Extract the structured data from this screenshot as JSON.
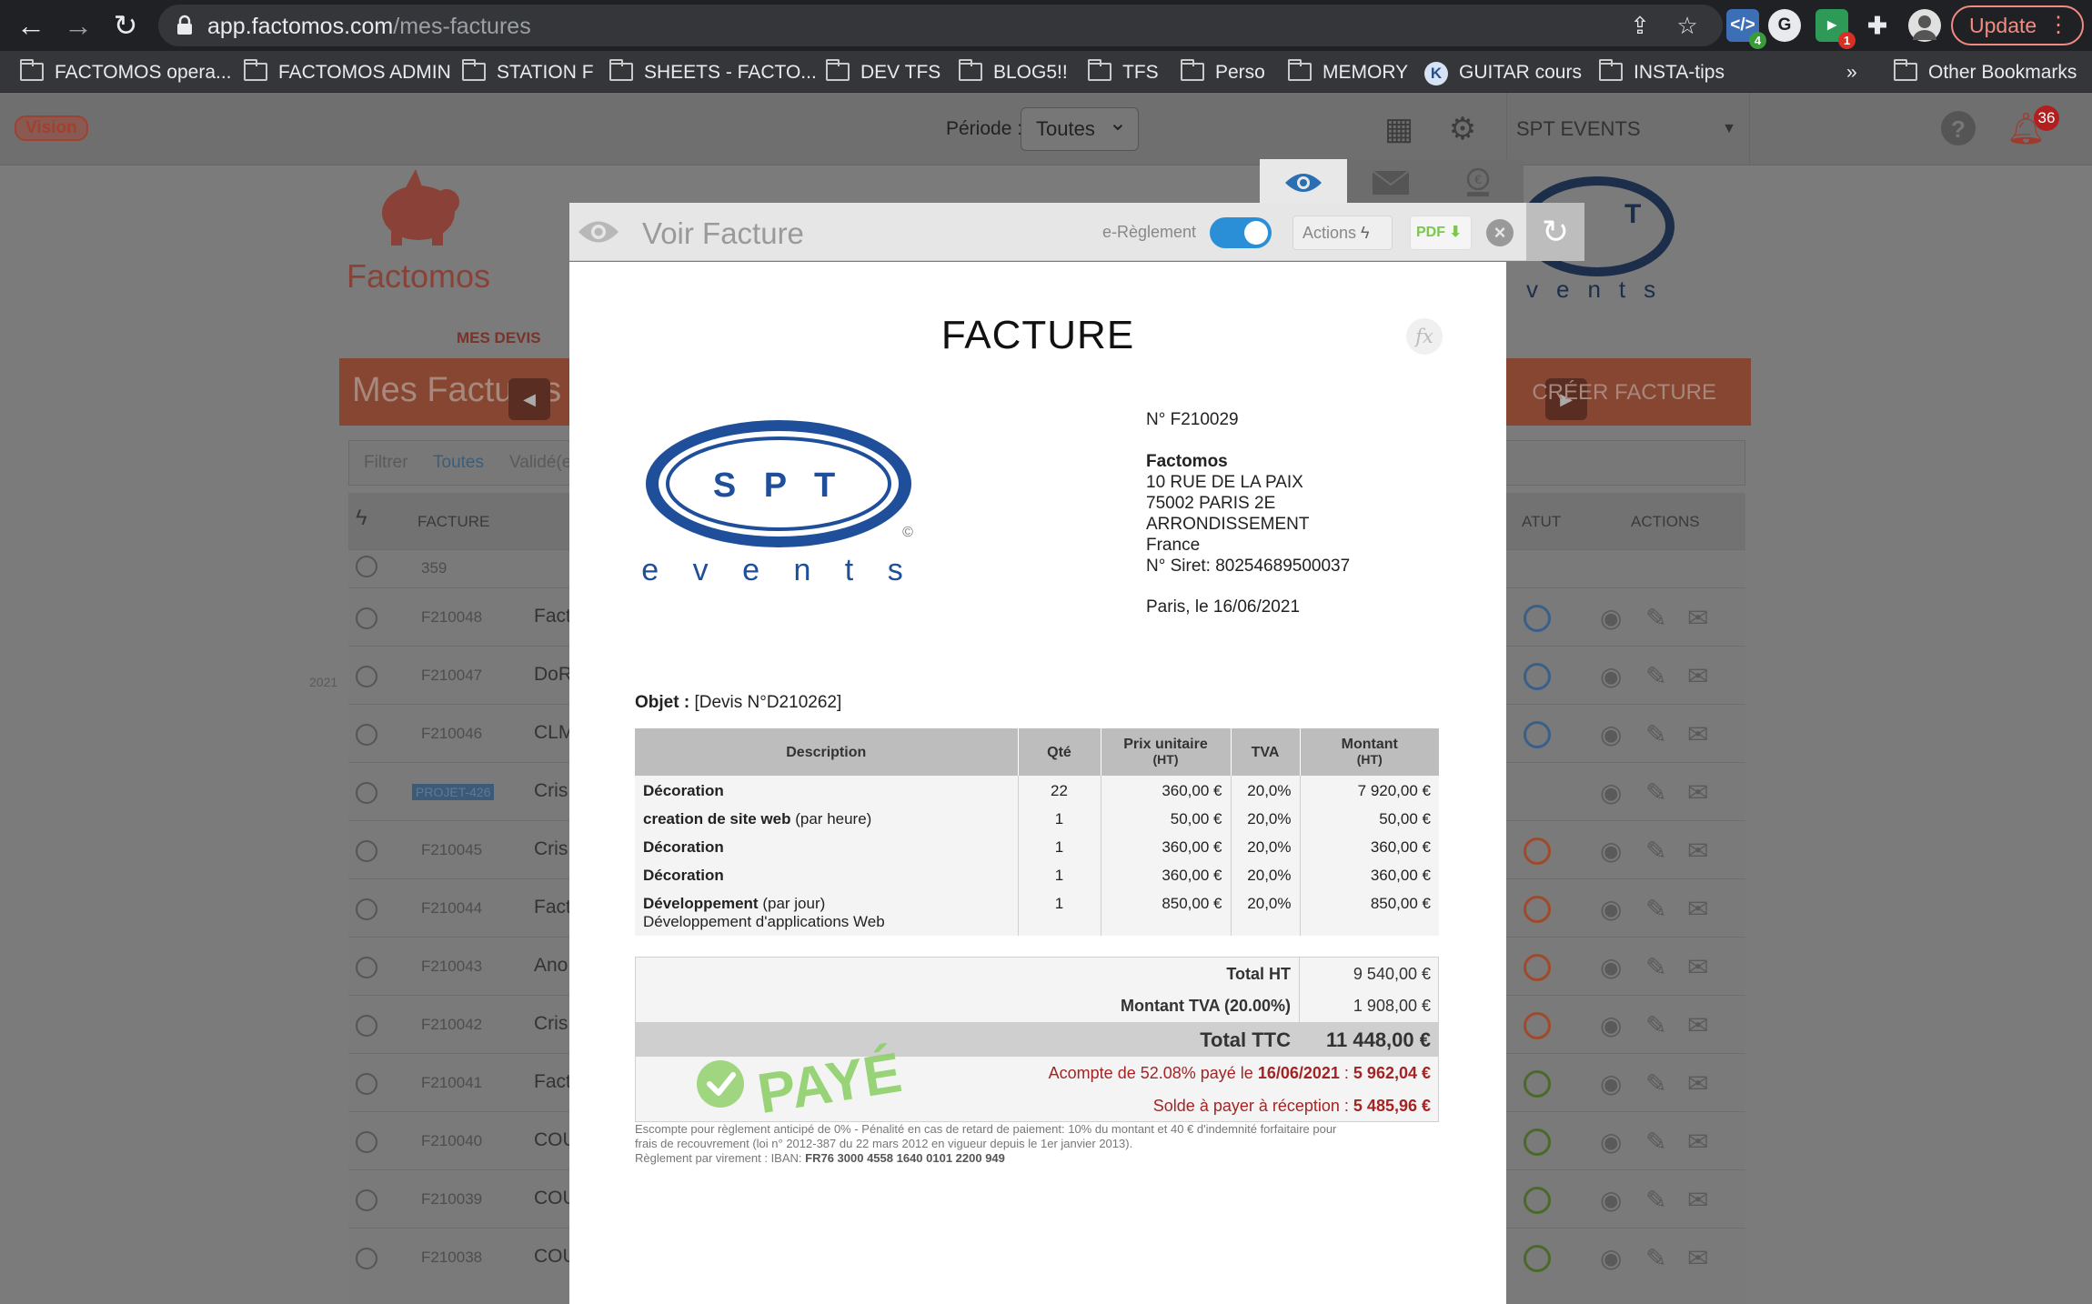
{
  "browser": {
    "url_host": "app.factomos.com",
    "url_path": "/mes-factures",
    "update_label": "Update",
    "extensions": [
      {
        "name": "dev-extension",
        "badge": "4"
      },
      {
        "name": "grammarly-extension",
        "badge": ""
      },
      {
        "name": "green-extension",
        "badge": "1"
      }
    ],
    "bookmarks": [
      "FACTOMOS opera...",
      "FACTOMOS ADMIN",
      "STATION F",
      "SHEETS - FACTO...",
      "DEV TFS",
      "BLOG5!!",
      "TFS",
      "Perso",
      "MEMORY",
      "GUITAR cours",
      "INSTA-tips"
    ],
    "more_bookmarks": "»",
    "other_bookmarks": "Other Bookmarks"
  },
  "app": {
    "vision_badge": "Vision",
    "periode_label": "Période :",
    "periode_value": "Toutes",
    "company": "SPT EVENTS",
    "notifications_count": "36",
    "brand": "Factomos",
    "mes_devis": "MES DEVIS",
    "page_title": "Mes Factures",
    "create_button": "CRÉER FACTURE",
    "filters": {
      "filtrer": "Filtrer",
      "toutes": "Toutes",
      "validees": "Validé(e"
    },
    "columns": {
      "facture": "FACTURE",
      "statut": "ATUT",
      "actions": "ACTIONS"
    },
    "count": "359",
    "year": "2021",
    "rows": [
      {
        "num": "F210048",
        "client": "Fact"
      },
      {
        "num": "F210047",
        "client": "DoR"
      },
      {
        "num": "F210046",
        "client": "CLM"
      },
      {
        "num": "PROJET-426",
        "client": "Cris"
      },
      {
        "num": "F210045",
        "client": "Cris"
      },
      {
        "num": "F210044",
        "client": "Fact"
      },
      {
        "num": "F210043",
        "client": "Ano"
      },
      {
        "num": "F210042",
        "client": "Cris"
      },
      {
        "num": "F210041",
        "client": "Fact"
      },
      {
        "num": "F210040",
        "client": "COU"
      },
      {
        "num": "F210039",
        "client": "COU"
      },
      {
        "num": "F210038",
        "client": "COU"
      }
    ]
  },
  "modal": {
    "title": "Voir Facture",
    "ereglement_label": "e-Règlement",
    "ereglement_on": true,
    "actions_label": "Actions",
    "pdf_label": "PDF"
  },
  "invoice": {
    "heading": "FACTURE",
    "fx_label": "fx",
    "client_logo": {
      "line1": "S P T",
      "line2": "e v e n t s"
    },
    "number": "N° F210029",
    "issuer_name": "Factomos",
    "address_lines": [
      "10 RUE DE LA PAIX",
      "75002 PARIS 2E",
      "ARRONDISSEMENT",
      "France"
    ],
    "siret": "N° Siret: 80254689500037",
    "place_date": "Paris, le 16/06/2021",
    "objet_label": "Objet :",
    "objet_value": "[Devis N°D210262]",
    "headers": {
      "description": "Description",
      "qte": "Qté",
      "prix_unitaire": "Prix unitaire",
      "prix_unitaire_sub": "(HT)",
      "tva": "TVA",
      "montant": "Montant",
      "montant_sub": "(HT)"
    },
    "lines": [
      {
        "title": "Décoration",
        "suffix": "",
        "detail": "",
        "qte": "22",
        "pu": "360,00 €",
        "tva": "20,0%",
        "montant": "7 920,00 €"
      },
      {
        "title": "creation de site web",
        "suffix": "(par heure)",
        "detail": "",
        "qte": "1",
        "pu": "50,00 €",
        "tva": "20,0%",
        "montant": "50,00 €"
      },
      {
        "title": "Décoration",
        "suffix": "",
        "detail": "",
        "qte": "1",
        "pu": "360,00 €",
        "tva": "20,0%",
        "montant": "360,00 €"
      },
      {
        "title": "Décoration",
        "suffix": "",
        "detail": "",
        "qte": "1",
        "pu": "360,00 €",
        "tva": "20,0%",
        "montant": "360,00 €"
      },
      {
        "title": "Développement",
        "suffix": "(par jour)",
        "detail": "Développement d'applications Web",
        "qte": "1",
        "pu": "850,00 €",
        "tva": "20,0%",
        "montant": "850,00 €"
      }
    ],
    "total_ht_label": "Total HT",
    "total_ht": "9 540,00 €",
    "tva_label": "Montant TVA (20.00%)",
    "tva_amount": "1 908,00 €",
    "ttc_label": "Total TTC",
    "ttc_amount": "11 448,00 €",
    "acompte_prefix": "Acompte de 52.08% payé le ",
    "acompte_date": "16/06/2021",
    "acompte_mid": " : ",
    "acompte_amount": "5 962,04 €",
    "solde_prefix": "Solde à payer à réception : ",
    "solde_amount": "5 485,96 €",
    "paid_stamp": "PAYÉ",
    "footnote_1": "Escompte pour règlement anticipé de 0% - Pénalité en cas de retard de paiement: 10% du montant et 40 € d'indemnité forfaitaire pour",
    "footnote_2": "frais de recouvrement (loi n° 2012-387 du 22 mars 2012 en vigueur depuis le 1er janvier 2013).",
    "footnote_3_prefix": "Règlement par virement : IBAN: ",
    "iban": "FR76 3000 4558 1640 0101 2200 949"
  },
  "colors": {
    "accent_blue": "#2b8fd8",
    "brand_red": "#d94a38",
    "paid_green": "#7ec84a",
    "due_red": "#a32424"
  }
}
